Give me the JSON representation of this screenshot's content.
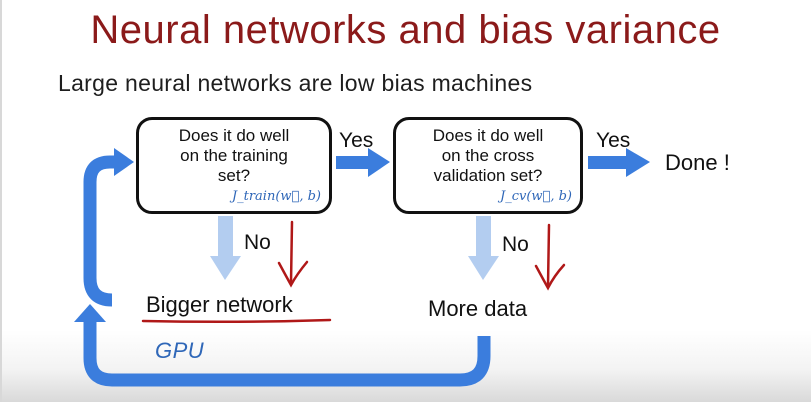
{
  "title": "Neural networks and bias variance",
  "subtitle": "Large neural networks are low bias machines",
  "box_training": {
    "question": "Does it do well\non the training\nset?",
    "formula": "J_train(w⃗, b)"
  },
  "box_cv": {
    "question": "Does it do well\non the cross\nvalidation set?",
    "formula": "J_cv(w⃗, b)"
  },
  "yes_label_1": "Yes",
  "yes_label_2": "Yes",
  "no_label_1": "No",
  "no_label_2": "No",
  "done_label": "Done !",
  "bigger_network": "Bigger network",
  "more_data": "More data",
  "gpu_annotation": "GPU",
  "colors": {
    "title": "#8b1a1a",
    "arrow_blue": "#3b7ddd",
    "arrow_light": "#b3cdf0",
    "handwriting_red": "#b01818",
    "formula_blue": "#2f67b8"
  }
}
